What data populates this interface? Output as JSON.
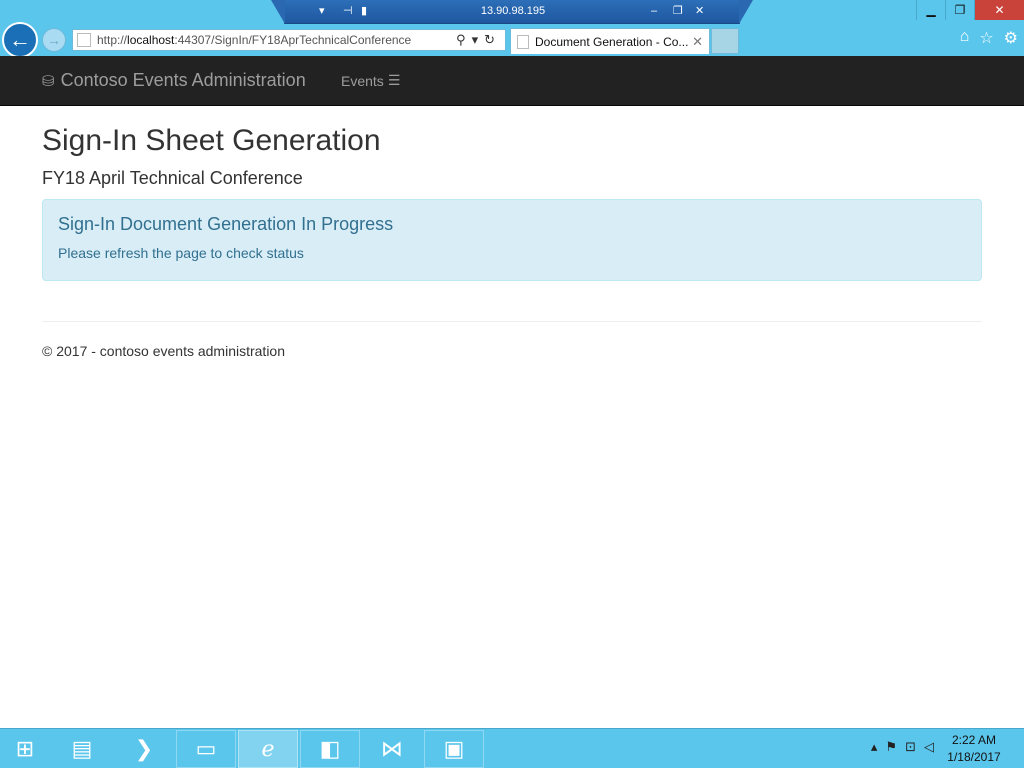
{
  "browser": {
    "remote_ip": "13.90.98.195",
    "url_prefix": "http://",
    "url_host": "localhost",
    "url_rest": ":44307/SignIn/FY18AprTechnicalConference",
    "tab_title": "Document Generation - Co..."
  },
  "navbar": {
    "brand": "Contoso Events Administration",
    "events_label": "Events"
  },
  "main": {
    "title": "Sign-In Sheet Generation",
    "event_name": "FY18 April Technical Conference",
    "alert_title": "Sign-In Document Generation In Progress",
    "alert_text": "Please refresh the page to check status"
  },
  "footer": {
    "text": "© 2017 - contoso events administration"
  },
  "taskbar": {
    "time": "2:22 AM",
    "date": "1/18/2017",
    "items": [
      "start-icon",
      "server-manager-icon",
      "powershell-icon",
      "file-explorer-icon",
      "internet-explorer-icon",
      "storage-explorer-icon",
      "visual-studio-icon",
      "document-app-icon"
    ]
  },
  "colors": {
    "chrome": "#5bc6ec",
    "navbar": "#222222",
    "alert_bg": "#d9edf7",
    "alert_text": "#31708f"
  }
}
